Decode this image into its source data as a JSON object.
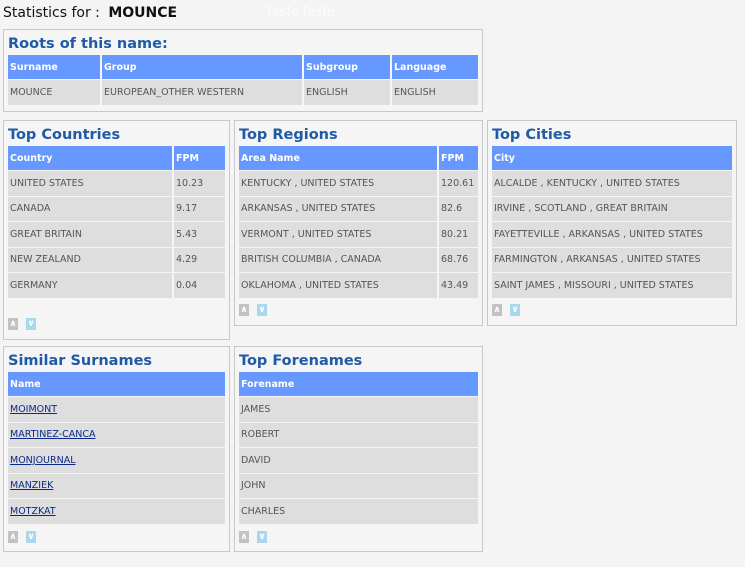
{
  "header": {
    "label": "Statistics for :",
    "surname": "MOUNCE",
    "ghost": "fasfe fasfe"
  },
  "pager": {
    "up": "∧",
    "down": "∨"
  },
  "roots": {
    "title": "Roots of this name:",
    "columns": [
      "Surname",
      "Group",
      "Subgroup",
      "Language"
    ],
    "row": [
      "MOUNCE",
      "EUROPEAN_OTHER WESTERN",
      "ENGLISH",
      "ENGLISH"
    ]
  },
  "top_countries": {
    "title": "Top Countries",
    "columns": [
      "Country",
      "FPM"
    ],
    "rows": [
      [
        "UNITED STATES",
        "10.23"
      ],
      [
        "CANADA",
        "9.17"
      ],
      [
        "GREAT BRITAIN",
        "5.43"
      ],
      [
        "NEW ZEALAND",
        "4.29"
      ],
      [
        "GERMANY",
        "0.04"
      ]
    ]
  },
  "top_regions": {
    "title": "Top Regions",
    "columns": [
      "Area Name",
      "FPM"
    ],
    "rows": [
      [
        "KENTUCKY , UNITED STATES",
        "120.61"
      ],
      [
        "ARKANSAS , UNITED STATES",
        "82.6"
      ],
      [
        "VERMONT , UNITED STATES",
        "80.21"
      ],
      [
        "BRITISH COLUMBIA , CANADA",
        "68.76"
      ],
      [
        "OKLAHOMA , UNITED STATES",
        "43.49"
      ]
    ]
  },
  "top_cities": {
    "title": "Top Cities",
    "columns": [
      "City"
    ],
    "rows": [
      [
        "ALCALDE , KENTUCKY , UNITED STATES"
      ],
      [
        "IRVINE , SCOTLAND , GREAT BRITAIN"
      ],
      [
        "FAYETTEVILLE , ARKANSAS , UNITED STATES"
      ],
      [
        "FARMINGTON , ARKANSAS , UNITED STATES"
      ],
      [
        "SAINT JAMES , MISSOURI , UNITED STATES"
      ]
    ]
  },
  "similar_surnames": {
    "title": "Similar Surnames",
    "columns": [
      "Name"
    ],
    "rows": [
      [
        "MOIMONT"
      ],
      [
        "MARTINEZ-CANCA"
      ],
      [
        "MONJOURNAL"
      ],
      [
        "MANZIEK"
      ],
      [
        "MOTZKAT"
      ]
    ]
  },
  "top_forenames": {
    "title": "Top Forenames",
    "columns": [
      "Forename"
    ],
    "rows": [
      [
        "JAMES"
      ],
      [
        "ROBERT"
      ],
      [
        "DAVID"
      ],
      [
        "JOHN"
      ],
      [
        "CHARLES"
      ]
    ]
  }
}
